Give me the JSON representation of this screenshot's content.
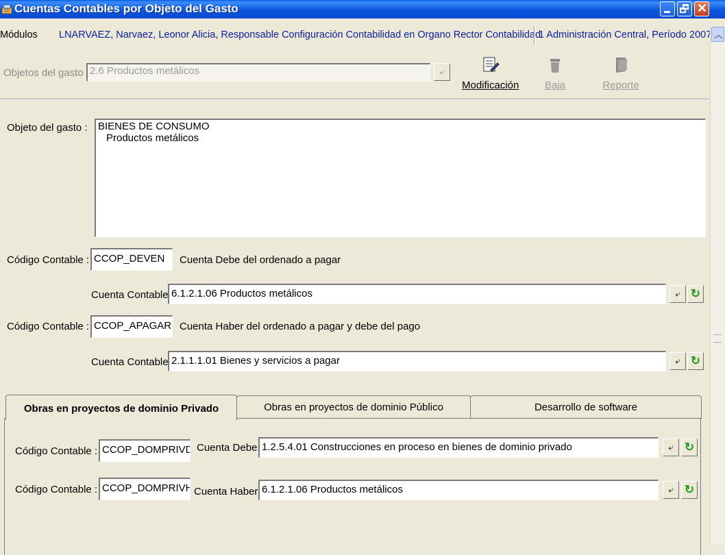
{
  "window": {
    "title": "Cuentas Contables por Objeto del Gasto"
  },
  "infobar": {
    "modules": "Módulos",
    "user": "LNARVAEZ, Narvaez, Leonor Alicia, Responsable Configuración Contabilidad en Organo Rector Contabilidad",
    "context": "1 Administración Central, Período 2007"
  },
  "selector": {
    "label": "Objetos del gasto :",
    "value": "2.6 Productos metálicos"
  },
  "toolbar": {
    "modificacion": "Modificación",
    "baja": "Baja",
    "reporte": "Reporte"
  },
  "objeto": {
    "label": "Objeto del gasto :",
    "line1": "BIENES DE CONSUMO",
    "line2": "Productos metálicos"
  },
  "codigo1": {
    "label": "Código Contable :",
    "value": "CCOP_DEVEN",
    "description": "Cuenta Debe del ordenado a pagar",
    "cuenta_label": "Cuenta Contable:",
    "cuenta_value": "6.1.2.1.06 Productos metálicos"
  },
  "codigo2": {
    "label": "Código Contable :",
    "value": "CCOP_APAGAR",
    "description": "Cuenta Haber del ordenado a pagar y debe del pago",
    "cuenta_label": "Cuenta Contable:",
    "cuenta_value": "2.1.1.1.01 Bienes y servicios a pagar"
  },
  "tabs": [
    {
      "label": "Obras en proyectos de dominio Privado"
    },
    {
      "label": "Obras en proyectos de dominio Público"
    },
    {
      "label": "Desarrollo de software"
    }
  ],
  "tab_content": {
    "row1": {
      "label": "Código Contable :",
      "value": "CCOP_DOMPRIVD",
      "cuenta_label": "Cuenta Debe:",
      "cuenta_value": "1.2.5.4.01 Construcciones en proceso en bienes de dominio privado"
    },
    "row2": {
      "label": "Código Contable :",
      "value": "CCOP_DOMPRIVH",
      "cuenta_label": "Cuenta Haber:",
      "cuenta_value": "6.1.2.1.06 Productos metálicos"
    }
  },
  "colors": {
    "titlebar": "#0a56df",
    "infotext": "#0a1f9c",
    "window_bg": "#ece9d8",
    "reset_green": "#1f9a1f"
  }
}
